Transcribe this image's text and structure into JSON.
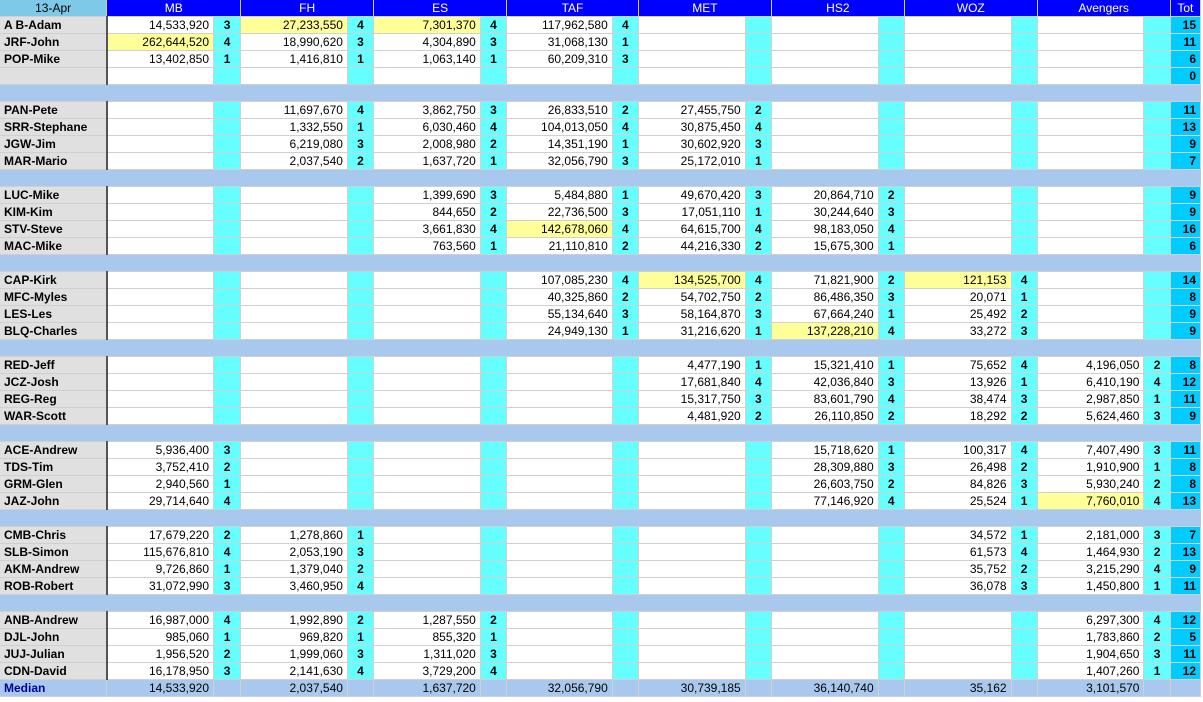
{
  "header": {
    "date": "13-Apr",
    "columns": [
      "MB",
      "FH",
      "ES",
      "TAF",
      "MET",
      "HS2",
      "WOZ",
      "Avengers"
    ],
    "total": "Tot"
  },
  "groups": [
    [
      {
        "name": "A B-Adam",
        "cells": [
          [
            "14,533,920",
            "3"
          ],
          [
            "27,233,550",
            "4",
            1
          ],
          [
            "7,301,370",
            "4",
            1
          ],
          [
            "117,962,580",
            "4"
          ],
          [
            "",
            ""
          ],
          [
            "",
            ""
          ],
          [
            "",
            ""
          ],
          [
            "",
            ""
          ]
        ],
        "total": "15"
      },
      {
        "name": "JRF-John",
        "cells": [
          [
            "262,644,520",
            "4",
            1
          ],
          [
            "18,990,620",
            "3"
          ],
          [
            "4,304,890",
            "3"
          ],
          [
            "31,068,130",
            "1"
          ],
          [
            "",
            ""
          ],
          [
            "",
            ""
          ],
          [
            "",
            ""
          ],
          [
            "",
            ""
          ]
        ],
        "total": "11"
      },
      {
        "name": "POP-Mike",
        "cells": [
          [
            "13,402,850",
            "1"
          ],
          [
            "1,416,810",
            "1"
          ],
          [
            "1,063,140",
            "1"
          ],
          [
            "60,209,310",
            "3"
          ],
          [
            "",
            ""
          ],
          [
            "",
            ""
          ],
          [
            "",
            ""
          ],
          [
            "",
            ""
          ]
        ],
        "total": "6"
      },
      {
        "name": "",
        "cells": [
          [
            "",
            ""
          ],
          [
            "",
            ""
          ],
          [
            "",
            ""
          ],
          [
            "",
            ""
          ],
          [
            "",
            ""
          ],
          [
            "",
            ""
          ],
          [
            "",
            ""
          ],
          [
            "",
            ""
          ]
        ],
        "total": "0"
      }
    ],
    [
      {
        "name": "PAN-Pete",
        "cells": [
          [
            "",
            ""
          ],
          [
            "11,697,670",
            "4"
          ],
          [
            "3,862,750",
            "3"
          ],
          [
            "26,833,510",
            "2"
          ],
          [
            "27,455,750",
            "2"
          ],
          [
            "",
            ""
          ],
          [
            "",
            ""
          ],
          [
            "",
            ""
          ]
        ],
        "total": "11"
      },
      {
        "name": "SRR-Stephane",
        "cells": [
          [
            "",
            ""
          ],
          [
            "1,332,550",
            "1"
          ],
          [
            "6,030,460",
            "4"
          ],
          [
            "104,013,050",
            "4"
          ],
          [
            "30,875,450",
            "4"
          ],
          [
            "",
            ""
          ],
          [
            "",
            ""
          ],
          [
            "",
            ""
          ]
        ],
        "total": "13"
      },
      {
        "name": "JGW-Jim",
        "cells": [
          [
            "",
            ""
          ],
          [
            "6,219,080",
            "3"
          ],
          [
            "2,008,980",
            "2"
          ],
          [
            "14,351,190",
            "1"
          ],
          [
            "30,602,920",
            "3"
          ],
          [
            "",
            ""
          ],
          [
            "",
            ""
          ],
          [
            "",
            ""
          ]
        ],
        "total": "9"
      },
      {
        "name": "MAR-Mario",
        "cells": [
          [
            "",
            ""
          ],
          [
            "2,037,540",
            "2"
          ],
          [
            "1,637,720",
            "1"
          ],
          [
            "32,056,790",
            "3"
          ],
          [
            "25,172,010",
            "1"
          ],
          [
            "",
            ""
          ],
          [
            "",
            ""
          ],
          [
            "",
            ""
          ]
        ],
        "total": "7"
      }
    ],
    [
      {
        "name": "LUC-Mike",
        "cells": [
          [
            "",
            ""
          ],
          [
            "",
            ""
          ],
          [
            "1,399,690",
            "3"
          ],
          [
            "5,484,880",
            "1"
          ],
          [
            "49,670,420",
            "3"
          ],
          [
            "20,864,710",
            "2"
          ],
          [
            "",
            ""
          ],
          [
            "",
            ""
          ]
        ],
        "total": "9"
      },
      {
        "name": "KIM-Kim",
        "cells": [
          [
            "",
            ""
          ],
          [
            "",
            ""
          ],
          [
            "844,650",
            "2"
          ],
          [
            "22,736,500",
            "3"
          ],
          [
            "17,051,110",
            "1"
          ],
          [
            "30,244,640",
            "3"
          ],
          [
            "",
            ""
          ],
          [
            "",
            ""
          ]
        ],
        "total": "9"
      },
      {
        "name": "STV-Steve",
        "cells": [
          [
            "",
            ""
          ],
          [
            "",
            ""
          ],
          [
            "3,661,830",
            "4"
          ],
          [
            "142,678,060",
            "4",
            1
          ],
          [
            "64,615,700",
            "4"
          ],
          [
            "98,183,050",
            "4"
          ],
          [
            "",
            ""
          ],
          [
            "",
            ""
          ]
        ],
        "total": "16"
      },
      {
        "name": "MAC-Mike",
        "cells": [
          [
            "",
            ""
          ],
          [
            "",
            ""
          ],
          [
            "763,560",
            "1"
          ],
          [
            "21,110,810",
            "2"
          ],
          [
            "44,216,330",
            "2"
          ],
          [
            "15,675,300",
            "1"
          ],
          [
            "",
            ""
          ],
          [
            "",
            ""
          ]
        ],
        "total": "6"
      }
    ],
    [
      {
        "name": "CAP-Kirk",
        "cells": [
          [
            "",
            ""
          ],
          [
            "",
            ""
          ],
          [
            "",
            ""
          ],
          [
            "107,085,230",
            "4"
          ],
          [
            "134,525,700",
            "4",
            1
          ],
          [
            "71,821,900",
            "2"
          ],
          [
            "121,153",
            "4",
            1
          ],
          [
            "",
            ""
          ]
        ],
        "total": "14"
      },
      {
        "name": "MFC-Myles",
        "cells": [
          [
            "",
            ""
          ],
          [
            "",
            ""
          ],
          [
            "",
            ""
          ],
          [
            "40,325,860",
            "2"
          ],
          [
            "54,702,750",
            "2"
          ],
          [
            "86,486,350",
            "3"
          ],
          [
            "20,071",
            "1"
          ],
          [
            "",
            ""
          ]
        ],
        "total": "8"
      },
      {
        "name": "LES-Les",
        "cells": [
          [
            "",
            ""
          ],
          [
            "",
            ""
          ],
          [
            "",
            ""
          ],
          [
            "55,134,640",
            "3"
          ],
          [
            "58,164,870",
            "3"
          ],
          [
            "67,664,240",
            "1"
          ],
          [
            "25,492",
            "2"
          ],
          [
            "",
            ""
          ]
        ],
        "total": "9"
      },
      {
        "name": "BLQ-Charles",
        "cells": [
          [
            "",
            ""
          ],
          [
            "",
            ""
          ],
          [
            "",
            ""
          ],
          [
            "24,949,130",
            "1"
          ],
          [
            "31,216,620",
            "1"
          ],
          [
            "137,228,210",
            "4",
            1
          ],
          [
            "33,272",
            "3"
          ],
          [
            "",
            ""
          ]
        ],
        "total": "9"
      }
    ],
    [
      {
        "name": "RED-Jeff",
        "cells": [
          [
            "",
            ""
          ],
          [
            "",
            ""
          ],
          [
            "",
            ""
          ],
          [
            "",
            ""
          ],
          [
            "4,477,190",
            "1"
          ],
          [
            "15,321,410",
            "1"
          ],
          [
            "75,652",
            "4"
          ],
          [
            "4,196,050",
            "2"
          ]
        ],
        "total": "8"
      },
      {
        "name": "JCZ-Josh",
        "cells": [
          [
            "",
            ""
          ],
          [
            "",
            ""
          ],
          [
            "",
            ""
          ],
          [
            "",
            ""
          ],
          [
            "17,681,840",
            "4"
          ],
          [
            "42,036,840",
            "3"
          ],
          [
            "13,926",
            "1"
          ],
          [
            "6,410,190",
            "4"
          ]
        ],
        "total": "12"
      },
      {
        "name": "REG-Reg",
        "cells": [
          [
            "",
            ""
          ],
          [
            "",
            ""
          ],
          [
            "",
            ""
          ],
          [
            "",
            ""
          ],
          [
            "15,317,750",
            "3"
          ],
          [
            "83,601,790",
            "4"
          ],
          [
            "38,474",
            "3"
          ],
          [
            "2,987,850",
            "1"
          ]
        ],
        "total": "11"
      },
      {
        "name": "WAR-Scott",
        "cells": [
          [
            "",
            ""
          ],
          [
            "",
            ""
          ],
          [
            "",
            ""
          ],
          [
            "",
            ""
          ],
          [
            "4,481,920",
            "2"
          ],
          [
            "26,110,850",
            "2"
          ],
          [
            "18,292",
            "2"
          ],
          [
            "5,624,460",
            "3"
          ]
        ],
        "total": "9"
      }
    ],
    [
      {
        "name": "ACE-Andrew",
        "cells": [
          [
            "5,936,400",
            "3"
          ],
          [
            "",
            ""
          ],
          [
            "",
            ""
          ],
          [
            "",
            ""
          ],
          [
            "",
            ""
          ],
          [
            "15,718,620",
            "1"
          ],
          [
            "100,317",
            "4"
          ],
          [
            "7,407,490",
            "3"
          ]
        ],
        "total": "11"
      },
      {
        "name": "TDS-Tim",
        "cells": [
          [
            "3,752,410",
            "2"
          ],
          [
            "",
            ""
          ],
          [
            "",
            ""
          ],
          [
            "",
            ""
          ],
          [
            "",
            ""
          ],
          [
            "28,309,880",
            "3"
          ],
          [
            "26,498",
            "2"
          ],
          [
            "1,910,900",
            "1"
          ]
        ],
        "total": "8"
      },
      {
        "name": "GRM-Glen",
        "cells": [
          [
            "2,940,560",
            "1"
          ],
          [
            "",
            ""
          ],
          [
            "",
            ""
          ],
          [
            "",
            ""
          ],
          [
            "",
            ""
          ],
          [
            "26,603,750",
            "2"
          ],
          [
            "84,826",
            "3"
          ],
          [
            "5,930,240",
            "2"
          ]
        ],
        "total": "8"
      },
      {
        "name": "JAZ-John",
        "cells": [
          [
            "29,714,640",
            "4"
          ],
          [
            "",
            ""
          ],
          [
            "",
            ""
          ],
          [
            "",
            ""
          ],
          [
            "",
            ""
          ],
          [
            "77,146,920",
            "4"
          ],
          [
            "25,524",
            "1"
          ],
          [
            "7,760,010",
            "4",
            1
          ]
        ],
        "total": "13"
      }
    ],
    [
      {
        "name": "CMB-Chris",
        "cells": [
          [
            "17,679,220",
            "2"
          ],
          [
            "1,278,860",
            "1"
          ],
          [
            "",
            ""
          ],
          [
            "",
            ""
          ],
          [
            "",
            ""
          ],
          [
            "",
            ""
          ],
          [
            "34,572",
            "1"
          ],
          [
            "2,181,000",
            "3"
          ]
        ],
        "total": "7"
      },
      {
        "name": "SLB-Simon",
        "cells": [
          [
            "115,676,810",
            "4"
          ],
          [
            "2,053,190",
            "3"
          ],
          [
            "",
            ""
          ],
          [
            "",
            ""
          ],
          [
            "",
            ""
          ],
          [
            "",
            ""
          ],
          [
            "61,573",
            "4"
          ],
          [
            "1,464,930",
            "2"
          ]
        ],
        "total": "13"
      },
      {
        "name": "AKM-Andrew",
        "cells": [
          [
            "9,726,860",
            "1"
          ],
          [
            "1,379,040",
            "2"
          ],
          [
            "",
            ""
          ],
          [
            "",
            ""
          ],
          [
            "",
            ""
          ],
          [
            "",
            ""
          ],
          [
            "35,752",
            "2"
          ],
          [
            "3,215,290",
            "4"
          ]
        ],
        "total": "9"
      },
      {
        "name": "ROB-Robert",
        "cells": [
          [
            "31,072,990",
            "3"
          ],
          [
            "3,460,950",
            "4"
          ],
          [
            "",
            ""
          ],
          [
            "",
            ""
          ],
          [
            "",
            ""
          ],
          [
            "",
            ""
          ],
          [
            "36,078",
            "3"
          ],
          [
            "1,450,800",
            "1"
          ]
        ],
        "total": "11"
      }
    ],
    [
      {
        "name": "ANB-Andrew",
        "cells": [
          [
            "16,987,000",
            "4"
          ],
          [
            "1,992,890",
            "2"
          ],
          [
            "1,287,550",
            "2"
          ],
          [
            "",
            ""
          ],
          [
            "",
            ""
          ],
          [
            "",
            ""
          ],
          [
            "",
            ""
          ],
          [
            "6,297,300",
            "4"
          ]
        ],
        "total": "12"
      },
      {
        "name": "DJL-John",
        "cells": [
          [
            "985,060",
            "1"
          ],
          [
            "969,820",
            "1"
          ],
          [
            "855,320",
            "1"
          ],
          [
            "",
            ""
          ],
          [
            "",
            ""
          ],
          [
            "",
            ""
          ],
          [
            "",
            ""
          ],
          [
            "1,783,860",
            "2"
          ]
        ],
        "total": "5"
      },
      {
        "name": "JUJ-Julian",
        "cells": [
          [
            "1,956,520",
            "2"
          ],
          [
            "1,999,060",
            "3"
          ],
          [
            "1,311,020",
            "3"
          ],
          [
            "",
            ""
          ],
          [
            "",
            ""
          ],
          [
            "",
            ""
          ],
          [
            "",
            ""
          ],
          [
            "1,904,650",
            "3"
          ]
        ],
        "total": "11"
      },
      {
        "name": "CDN-David",
        "cells": [
          [
            "16,178,950",
            "3"
          ],
          [
            "2,141,630",
            "4"
          ],
          [
            "3,729,200",
            "4"
          ],
          [
            "",
            ""
          ],
          [
            "",
            ""
          ],
          [
            "",
            ""
          ],
          [
            "",
            ""
          ],
          [
            "1,407,260",
            "1"
          ]
        ],
        "total": "12"
      }
    ]
  ],
  "median": {
    "label": "Median",
    "values": [
      "14,533,920",
      "2,037,540",
      "1,637,720",
      "32,056,790",
      "30,739,185",
      "36,140,740",
      "35,162",
      "3,101,570"
    ]
  },
  "colors": {
    "header": "#0000ff",
    "rank": "#66ffff",
    "total": "#00ccff",
    "separator": "#a9c8ee",
    "highlight": "#ffff99",
    "name": "#e0e0e0"
  }
}
